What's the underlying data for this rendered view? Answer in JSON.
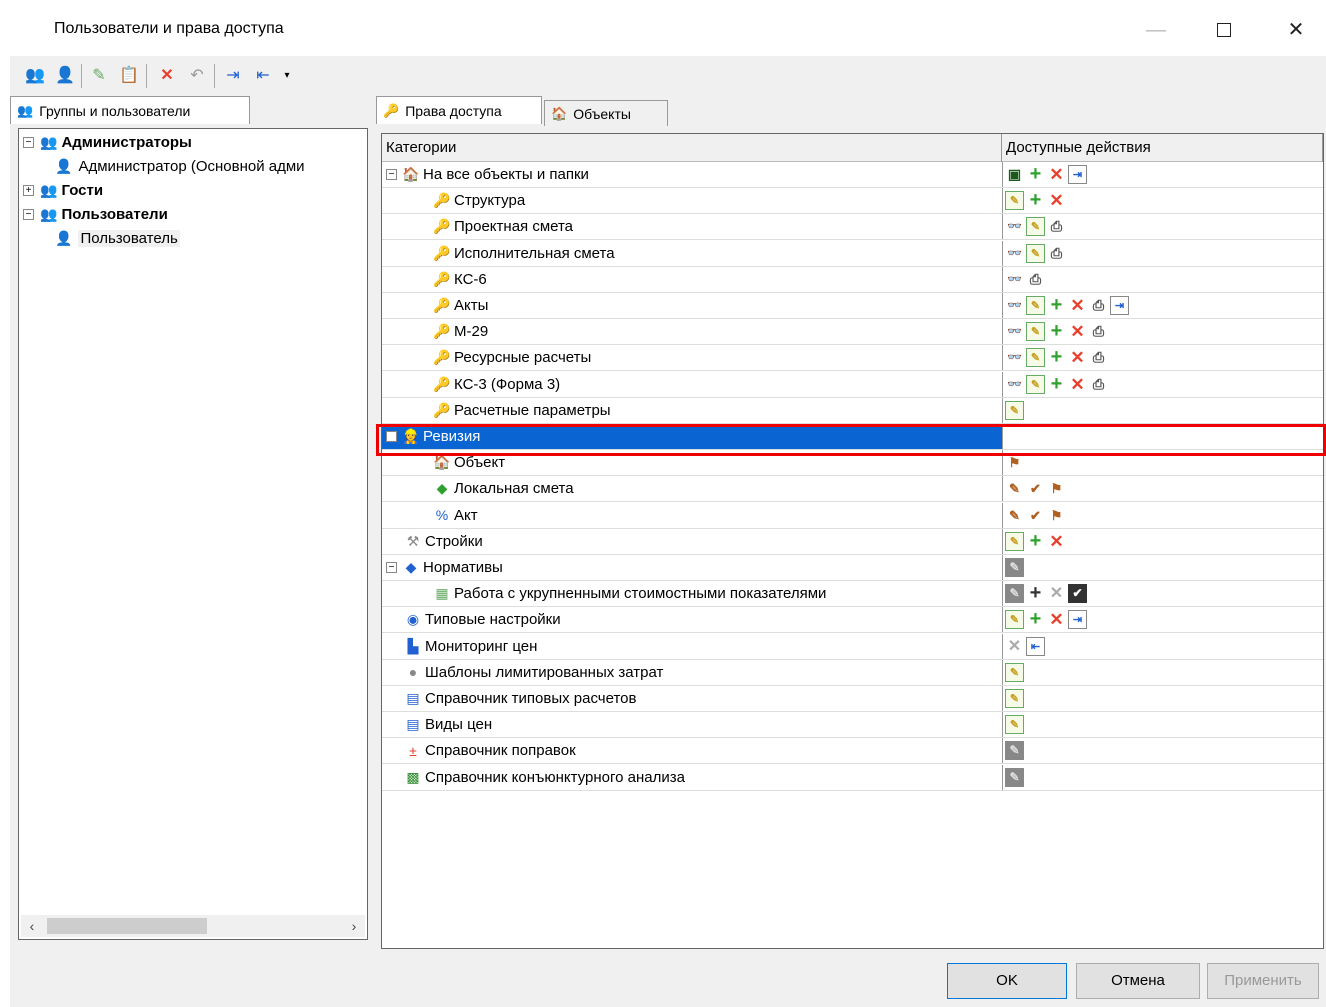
{
  "window": {
    "title": "Пользователи и права доступа",
    "minimize": "—",
    "close": "✕"
  },
  "tabs": {
    "left": "Группы и пользователи",
    "rights": "Права доступа",
    "objects": "Объекты"
  },
  "tree": [
    {
      "label": "Администраторы",
      "expand": "−"
    },
    {
      "label": "Администратор (Основной адми"
    },
    {
      "label": "Гости",
      "expand": "+"
    },
    {
      "label": "Пользователи",
      "expand": "−"
    },
    {
      "label": "Пользователь"
    }
  ],
  "grid": {
    "headers": {
      "category": "Категории",
      "actions": "Доступные действия"
    },
    "rows": [
      {
        "label": "На все объекты и папки",
        "expand": "−",
        "actions": [
          "monitor",
          "add",
          "delete",
          "document"
        ]
      },
      {
        "label": "Структура",
        "actions": [
          "edit",
          "add",
          "delete"
        ]
      },
      {
        "label": "Проектная смета",
        "actions": [
          "view",
          "edit",
          "print"
        ]
      },
      {
        "label": "Исполнительная смета",
        "actions": [
          "view",
          "edit",
          "print"
        ]
      },
      {
        "label": "КС-6",
        "actions": [
          "view",
          "print"
        ]
      },
      {
        "label": "Акты",
        "actions": [
          "view",
          "edit",
          "add",
          "delete",
          "print",
          "document"
        ]
      },
      {
        "label": "М-29",
        "actions": [
          "view",
          "edit",
          "add",
          "delete",
          "print"
        ]
      },
      {
        "label": "Ресурсные расчеты",
        "actions": [
          "view",
          "edit",
          "add",
          "delete",
          "print"
        ]
      },
      {
        "label": "КС-3 (Форма 3)",
        "actions": [
          "view",
          "edit",
          "add",
          "delete",
          "print"
        ]
      },
      {
        "label": "Расчетные параметры",
        "actions": [
          "edit"
        ]
      },
      {
        "label": "Ревизия",
        "expand": "−",
        "selected": true,
        "actions": []
      },
      {
        "label": "Объект",
        "actions": [
          "stamp"
        ]
      },
      {
        "label": "Локальная смета",
        "actions": [
          "pen",
          "pen-check",
          "stamp"
        ]
      },
      {
        "label": "Акт",
        "actions": [
          "pen",
          "pen-check",
          "stamp"
        ]
      },
      {
        "label": "Стройки",
        "actions": [
          "edit",
          "add",
          "delete"
        ]
      },
      {
        "label": "Нормативы",
        "expand": "−",
        "actions": [
          "gray-edit"
        ]
      },
      {
        "label": "Работа с укрупненными стоимостными показателями",
        "actions": [
          "gray-edit",
          "gray-add",
          "gray-delete",
          "checkbox"
        ]
      },
      {
        "label": "Типовые настройки",
        "actions": [
          "edit",
          "add",
          "delete",
          "document"
        ]
      },
      {
        "label": "Мониторинг цен",
        "actions": [
          "gray-delete",
          "import"
        ]
      },
      {
        "label": "Шаблоны лимитированных затрат",
        "actions": [
          "edit"
        ]
      },
      {
        "label": "Справочник типовых расчетов",
        "actions": [
          "edit"
        ]
      },
      {
        "label": "Виды цен",
        "actions": [
          "edit"
        ]
      },
      {
        "label": "Справочник поправок",
        "actions": [
          "gray-edit"
        ]
      },
      {
        "label": "Справочник конъюнктурного анализа",
        "actions": [
          "gray-edit"
        ]
      }
    ]
  },
  "buttons": {
    "ok": "OK",
    "cancel": "Отмена",
    "apply": "Применить"
  }
}
